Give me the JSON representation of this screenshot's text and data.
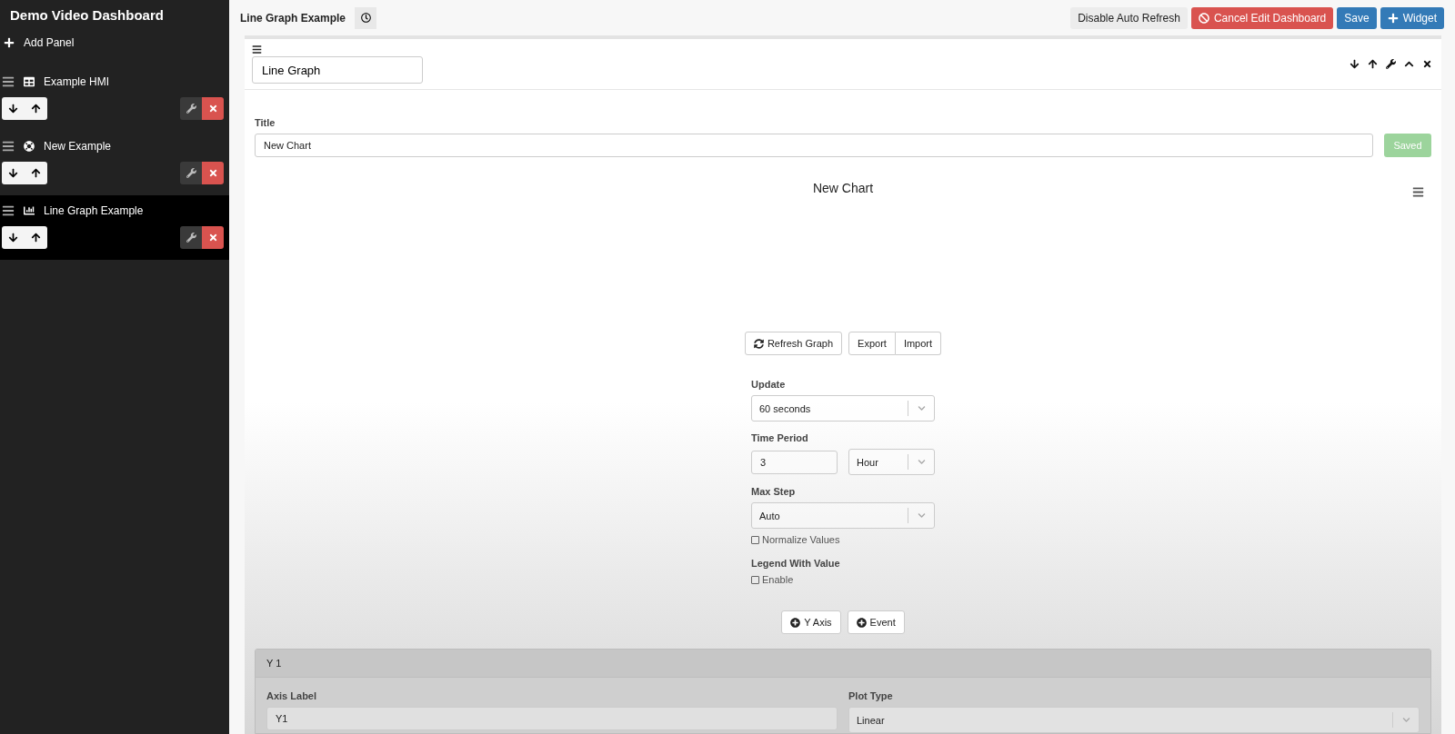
{
  "sidebar": {
    "title": "Demo Video Dashboard",
    "add_panel": "Add Panel",
    "panels": [
      {
        "name": "Example HMI",
        "kind": "table",
        "selected": false
      },
      {
        "name": "New Example",
        "kind": "ring",
        "selected": false
      },
      {
        "name": "Line Graph Example",
        "kind": "chart",
        "selected": true
      }
    ]
  },
  "topbar": {
    "title": "Line Graph Example",
    "buttons": [
      {
        "label": "Disable Auto Refresh",
        "kind": "light"
      },
      {
        "label": "Cancel Edit Dashboard",
        "kind": "danger"
      },
      {
        "label": "Save",
        "kind": "primary"
      },
      {
        "label": "Widget",
        "kind": "add"
      }
    ]
  },
  "widget": {
    "name": "Line Graph",
    "title_label": "Title",
    "title_value": "New Chart",
    "saved_button": {
      "label": "Saved",
      "disabled": true
    },
    "chart_title": "New Chart",
    "refresh_button": "Refresh Graph",
    "export_button": "Export",
    "import_button": "Import",
    "update": {
      "label": "Update",
      "value": "60 seconds"
    },
    "time_period": {
      "label": "Time Period",
      "value": "3",
      "unit": "Hour"
    },
    "max_step": {
      "label": "Max Step",
      "value": "Auto"
    },
    "normalize": {
      "label": "Normalize Values",
      "checked": false
    },
    "legend": {
      "label": "Legend With Value",
      "option": "Enable",
      "checked": false
    },
    "add_buttons": [
      "Y Axis",
      "Event"
    ],
    "axis": {
      "title": "Y 1",
      "axis_label": "Axis Label",
      "axis_value": "Y1",
      "plot_type_label": "Plot Type",
      "plot_type": "Linear"
    }
  }
}
